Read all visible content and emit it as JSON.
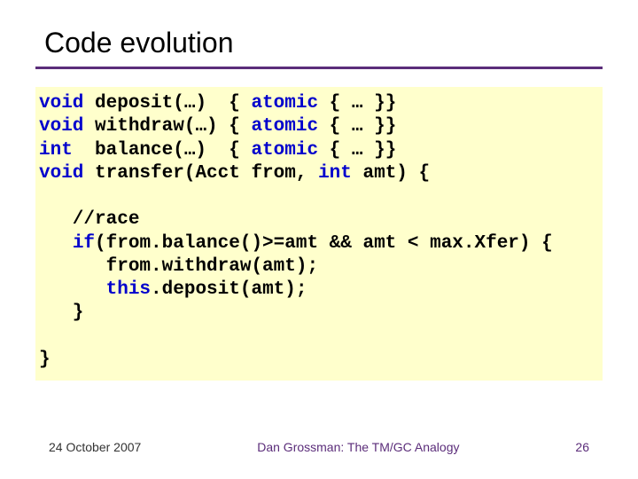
{
  "title": "Code evolution",
  "code": {
    "l1a": "void",
    "l1b": " deposit(…)  { ",
    "l1c": "atomic",
    "l1d": " { … }}",
    "l2a": "void",
    "l2b": " withdraw(…) { ",
    "l2c": "atomic",
    "l2d": " { … }}",
    "l3a": "int",
    "l3b": "  balance(…)  { ",
    "l3c": "atomic",
    "l3d": " { … }}",
    "l4a": "void",
    "l4b": " transfer(Acct from, ",
    "l4c": "int",
    "l4d": " amt) {",
    "l5": "",
    "l6": "   //race",
    "l7a": "   ",
    "l7b": "if",
    "l7c": "(from.balance()>=amt && amt < max.Xfer) {",
    "l8": "      from.withdraw(amt);",
    "l9a": "      ",
    "l9b": "this",
    "l9c": ".deposit(amt);",
    "l10": "   }",
    "l11": "",
    "l12": "}"
  },
  "footer": {
    "date": "24 October 2007",
    "center": "Dan Grossman: The TM/GC Analogy",
    "pagenum": "26"
  }
}
